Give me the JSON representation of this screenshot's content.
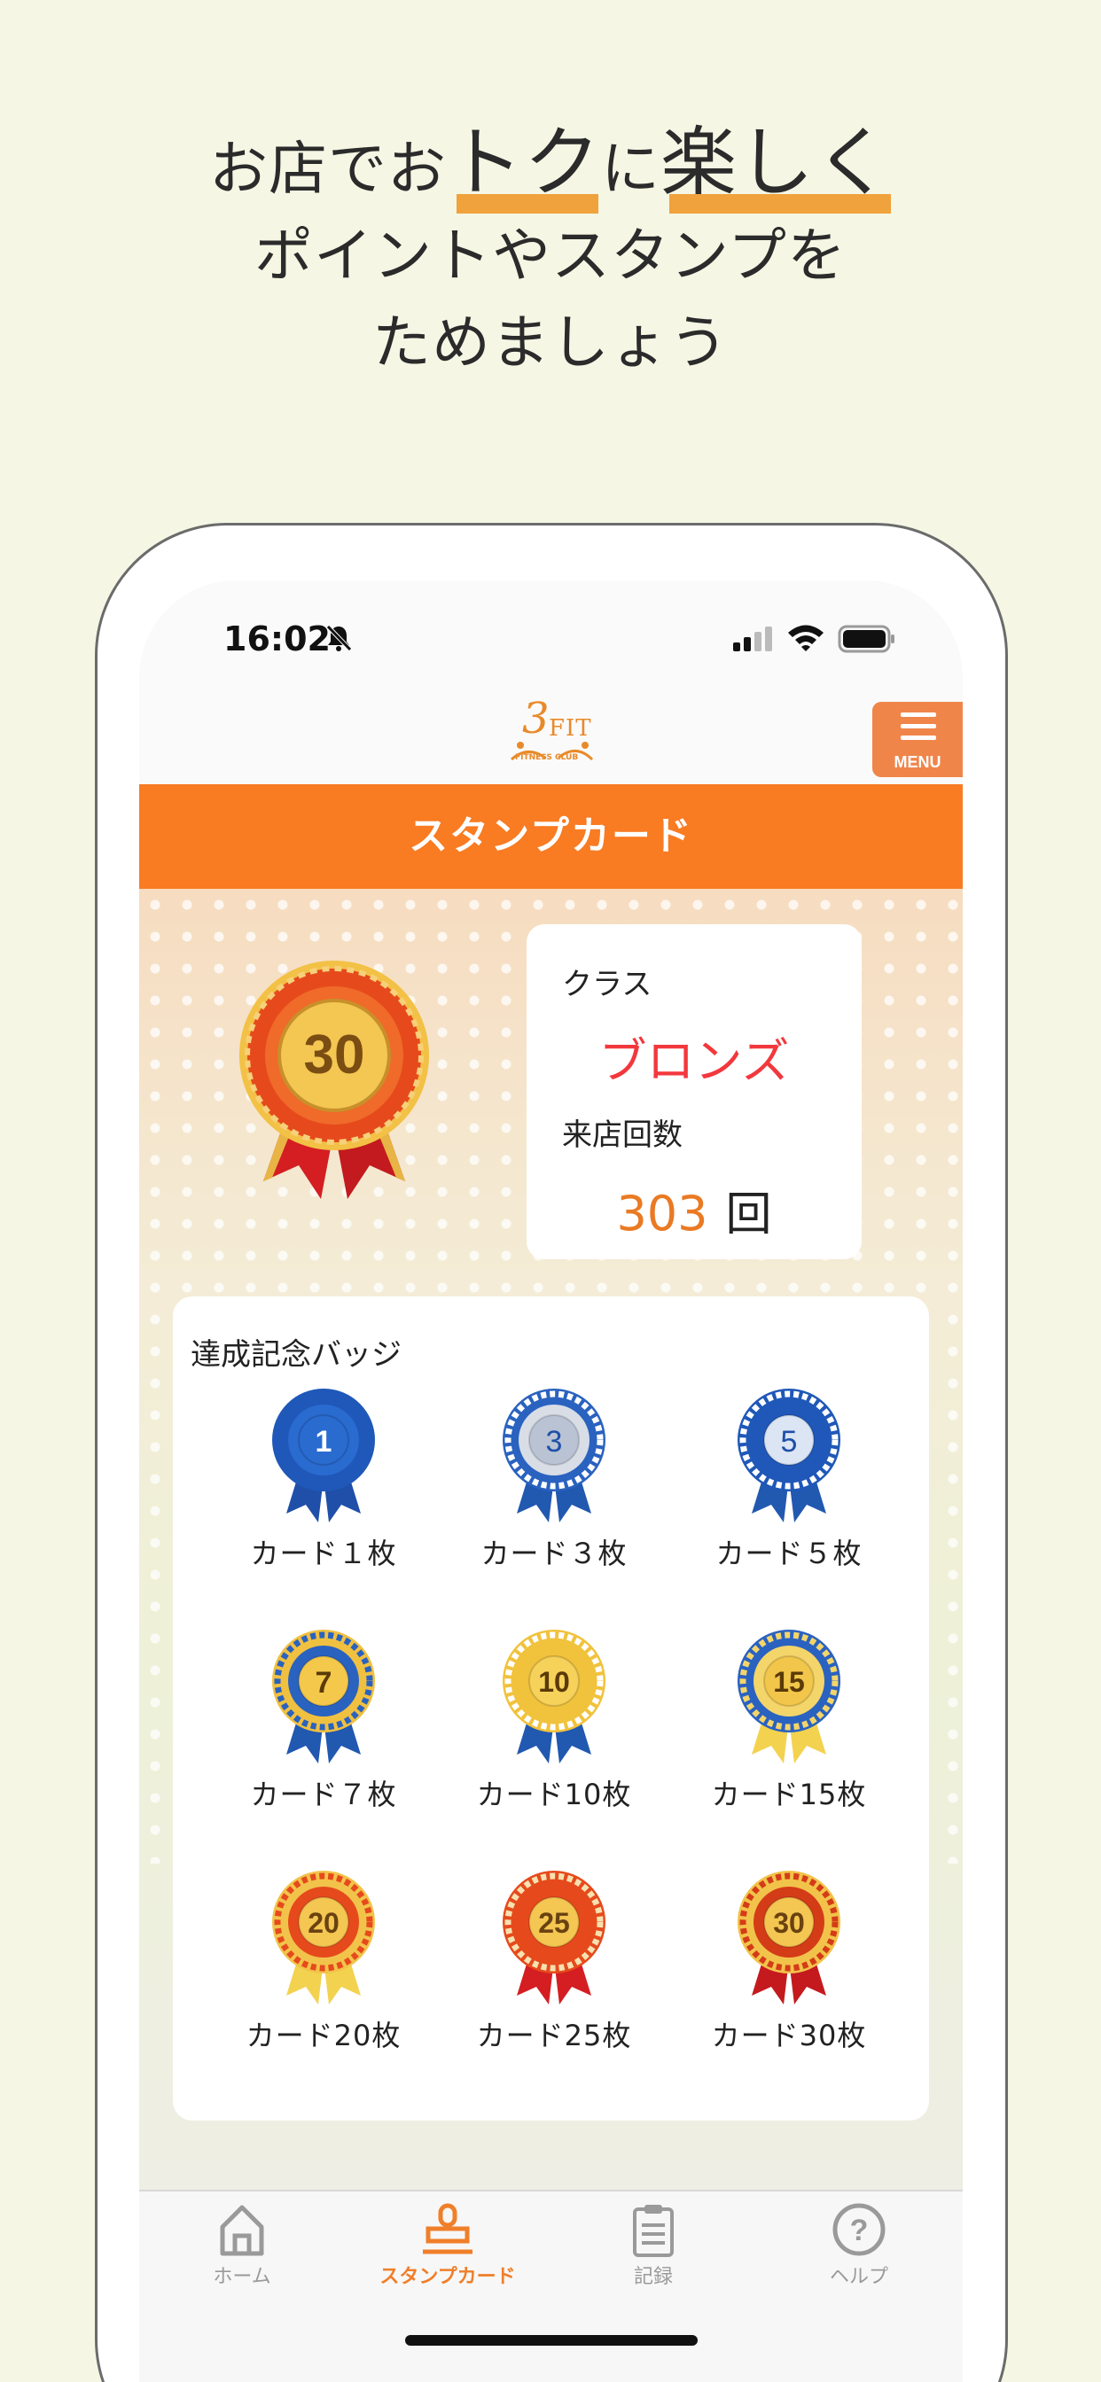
{
  "headline": {
    "line1_a": "お店でお",
    "line1_b": "トク",
    "line1_c": "に",
    "line1_d": "楽しく",
    "line2": "ポイントやスタンプを",
    "line3": "ためましょう"
  },
  "colors": {
    "background": "#f5f7e4",
    "accent_orange": "#f97b22",
    "highlight": "#f0a23c",
    "rank_red": "#f2383d",
    "visits_orange": "#ea7a23"
  },
  "status_bar": {
    "time": "16:02"
  },
  "app_header": {
    "logo_number": "3",
    "logo_text": "FIT",
    "logo_sub": "FITNESS CLUB",
    "menu_label": "MENU"
  },
  "page_title": "スタンプカード",
  "main_badge": {
    "number": "30"
  },
  "info": {
    "class_label": "クラス",
    "class_value": "ブロンズ",
    "visits_label": "来店回数",
    "visits_value": "303",
    "visits_unit": "回"
  },
  "badges": {
    "title": "達成記念バッジ",
    "items": [
      {
        "number": "1",
        "label": "カード１枚",
        "style": "blue"
      },
      {
        "number": "3",
        "label": "カード３枚",
        "style": "blue-silver"
      },
      {
        "number": "5",
        "label": "カード５枚",
        "style": "blue-ring"
      },
      {
        "number": "7",
        "label": "カード７枚",
        "style": "gold-blue"
      },
      {
        "number": "10",
        "label": "カード10枚",
        "style": "gold"
      },
      {
        "number": "15",
        "label": "カード15枚",
        "style": "gold-ring"
      },
      {
        "number": "20",
        "label": "カード20枚",
        "style": "red-gold"
      },
      {
        "number": "25",
        "label": "カード25枚",
        "style": "red-cream"
      },
      {
        "number": "30",
        "label": "カード30枚",
        "style": "red-dark"
      }
    ]
  },
  "tabs": [
    {
      "label": "ホーム",
      "icon": "home-icon",
      "active": false
    },
    {
      "label": "スタンプカード",
      "icon": "stamp-icon",
      "active": true
    },
    {
      "label": "記録",
      "icon": "clipboard-icon",
      "active": false
    },
    {
      "label": "ヘルプ",
      "icon": "help-icon",
      "active": false
    }
  ]
}
